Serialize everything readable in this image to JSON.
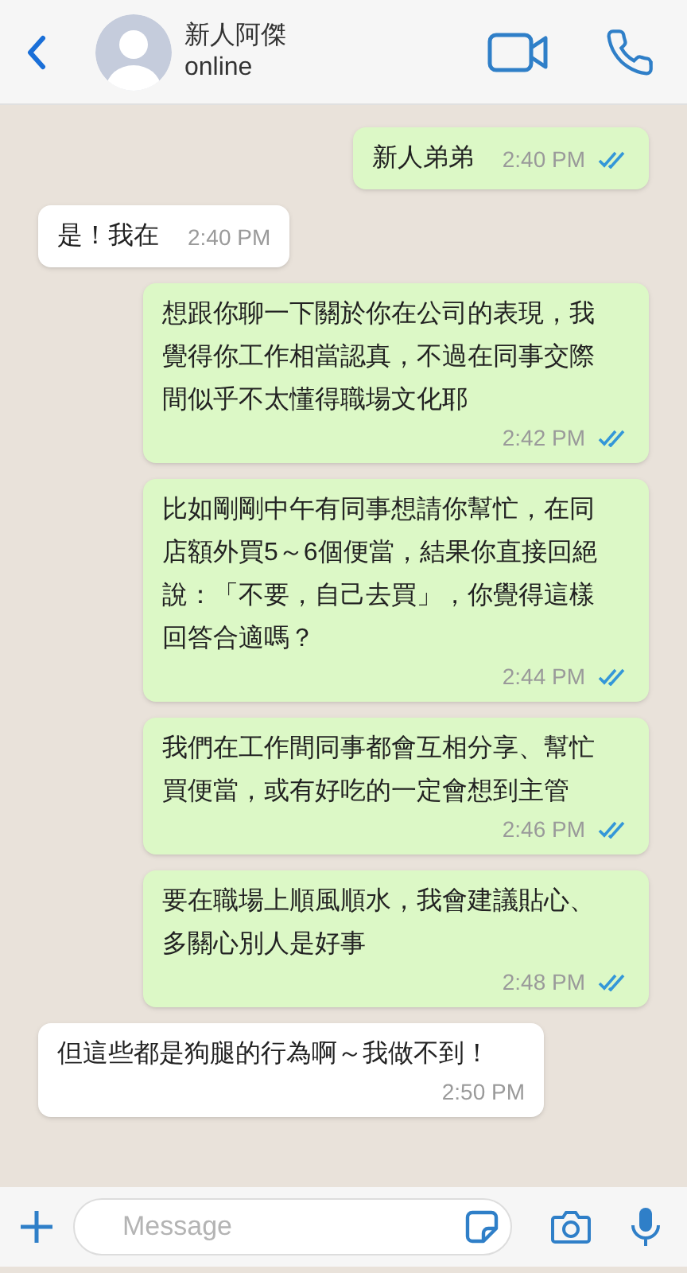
{
  "header": {
    "name": "新人阿傑",
    "status": "online"
  },
  "messages": [
    {
      "kind": "sent",
      "text": "新人弟弟",
      "time": "2:40 PM",
      "read": true
    },
    {
      "kind": "received",
      "text": "是！我在",
      "time": "2:40 PM"
    },
    {
      "kind": "sent",
      "text": "想跟你聊一下關於你在公司的表現，我覺得你工作相當認真，不過在同事交際間似乎不太懂得職場文化耶",
      "time": "2:42 PM",
      "read": true
    },
    {
      "kind": "sent",
      "text": "比如剛剛中午有同事想請你幫忙，在同店額外買5～6個便當，結果你直接回絕說：「不要，自己去買」，你覺得這樣回答合適嗎？",
      "time": "2:44 PM",
      "read": true
    },
    {
      "kind": "sent",
      "text": "我們在工作間同事都會互相分享、幫忙買便當，或有好吃的一定會想到主管",
      "time": "2:46 PM",
      "read": true
    },
    {
      "kind": "sent",
      "text": "要在職場上順風順水，我會建議貼心、多關心別人是好事",
      "time": "2:48 PM",
      "read": true
    },
    {
      "kind": "received",
      "text": "但這些都是狗腿的行為啊～我做不到！",
      "time": "2:50 PM"
    }
  ],
  "composer": {
    "placeholder": "Message"
  }
}
